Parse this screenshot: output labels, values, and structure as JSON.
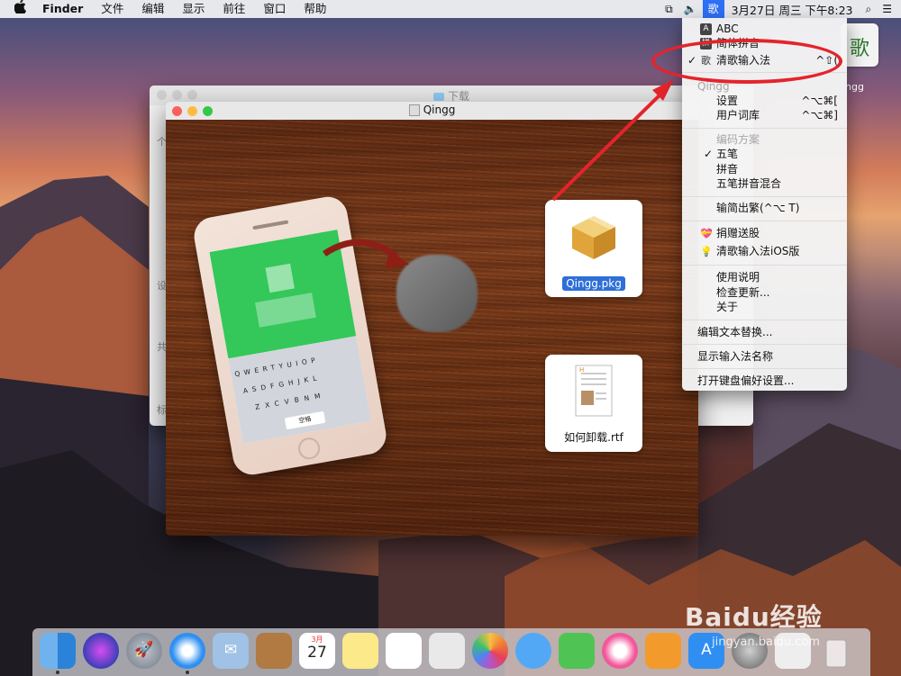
{
  "menubar": {
    "apple": "",
    "app": "Finder",
    "items": [
      "文件",
      "编辑",
      "显示",
      "前往",
      "窗口",
      "帮助"
    ],
    "ime_glyph": "歌",
    "date": "3月27日 周三 下午8:23",
    "status_icons": [
      "screen-mirroring-icon",
      "volume-icon",
      "input-method-icon",
      "search-icon",
      "list-icon"
    ]
  },
  "dropdown": {
    "items": [
      {
        "label": "ABC",
        "icon": "A"
      },
      {
        "label": "简体拼音",
        "icon": "拼"
      },
      {
        "label": "清歌输入法",
        "icon": "歌",
        "check": "✓",
        "shortcut": "^⇧("
      },
      {
        "label": "Qingg",
        "header": true
      },
      {
        "label": "设置",
        "shortcut": "^⌥⌘["
      },
      {
        "label": "用户词库",
        "shortcut": "^⌥⌘]"
      },
      {
        "label": "编码方案",
        "header": true
      },
      {
        "label": "五笔",
        "check": "✓"
      },
      {
        "label": "拼音"
      },
      {
        "label": "五笔拼音混合"
      },
      {
        "label": "输简出繁(^⌥ T)"
      },
      {
        "label": "捐赠送股",
        "icon": "💝"
      },
      {
        "label": "清歌输入法iOS版",
        "icon": "💡"
      },
      {
        "label": "使用说明"
      },
      {
        "label": "检查更新..."
      },
      {
        "label": "关于"
      },
      {
        "label": "编辑文本替换..."
      },
      {
        "label": "显示输入法名称"
      },
      {
        "label": "打开键盘偏好设置..."
      }
    ]
  },
  "back_window": {
    "title": "下载",
    "side_labels": [
      "个",
      "设",
      "共",
      "标"
    ]
  },
  "front_window": {
    "title": "Qingg"
  },
  "files": [
    {
      "label": "Qingg.pkg",
      "selected": true
    },
    {
      "label": "如何卸载.rtf",
      "selected": false
    }
  ],
  "phone": {
    "keyboard_rows": [
      "QWERTYUIOP",
      "ASDFGHJKL",
      "ZXCVBNM"
    ],
    "space_label": "空格"
  },
  "desktop": {
    "icon_glyph": "歌",
    "label": "ngg"
  },
  "dock": {
    "calendar_month": "3月",
    "calendar_day": "27"
  },
  "watermark": {
    "brand": "Baidu经验",
    "url": "jingyan.baidu.com"
  },
  "colors": {
    "accent": "#2d6ff5",
    "annotation": "#e3242b",
    "selection": "#2e6fd8"
  }
}
